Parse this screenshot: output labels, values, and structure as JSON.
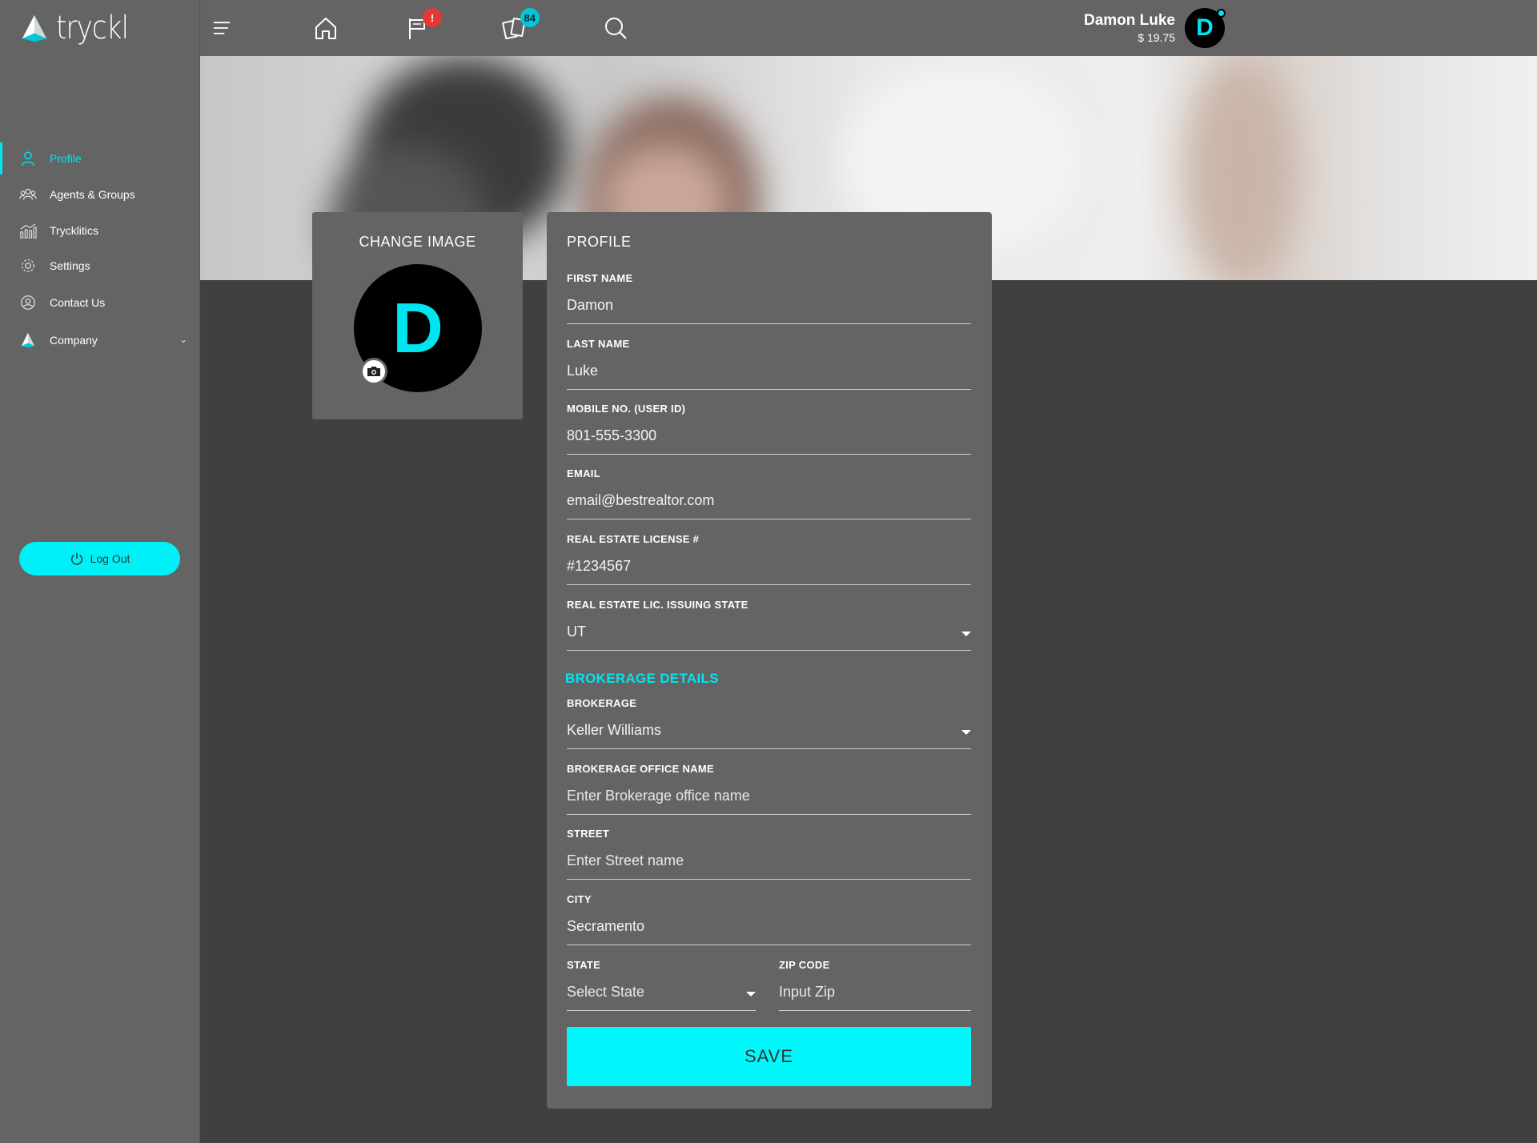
{
  "app": {
    "logo_text": "tryckl"
  },
  "topbar": {
    "flags_badge": "!",
    "cards_badge": "84",
    "user_name": "Damon Luke",
    "user_balance": "$ 19.75",
    "avatar_initial": "D"
  },
  "sidebar": {
    "items": [
      {
        "label": "Profile",
        "icon": "person-icon"
      },
      {
        "label": "Agents & Groups",
        "icon": "group-icon"
      },
      {
        "label": "Trycklitics",
        "icon": "chart-icon"
      },
      {
        "label": "Settings",
        "icon": "gear-icon"
      },
      {
        "label": "Contact Us",
        "icon": "contact-icon"
      },
      {
        "label": "Company",
        "icon": "company-logo-icon"
      }
    ],
    "logout_label": "Log Out"
  },
  "image_card": {
    "title": "CHANGE IMAGE",
    "avatar_initial": "D"
  },
  "profile": {
    "title": "PROFILE",
    "fields": {
      "first_name": {
        "label": "FIRST NAME",
        "value": "Damon"
      },
      "last_name": {
        "label": "LAST NAME",
        "value": "Luke"
      },
      "mobile": {
        "label": "MOBILE NO. (USER ID)",
        "value": "801-555-3300"
      },
      "email": {
        "label": "EMAIL",
        "value": "email@bestrealtor.com"
      },
      "license": {
        "label": "REAL ESTATE LICENSE #",
        "value": "#1234567"
      },
      "lic_state": {
        "label": "REAL ESTATE LIC. ISSUING STATE",
        "value": "UT"
      }
    },
    "brokerage_title": "BROKERAGE DETAILS",
    "brokerage": {
      "brokerage": {
        "label": "BROKERAGE",
        "value": "Keller Williams"
      },
      "office_name": {
        "label": "BROKERAGE OFFICE NAME",
        "placeholder": "Enter Brokerage office name"
      },
      "street": {
        "label": "STREET",
        "placeholder": "Enter Street name"
      },
      "city": {
        "label": "CITY",
        "value": "Secramento"
      },
      "state": {
        "label": "STATE",
        "placeholder": "Select State"
      },
      "zip": {
        "label": "ZIP CODE",
        "placeholder": "Input Zip"
      }
    },
    "save_label": "SAVE"
  },
  "colors": {
    "accent": "#00e5f0",
    "panel": "#646464",
    "background": "#404040",
    "alert": "#e53935"
  }
}
